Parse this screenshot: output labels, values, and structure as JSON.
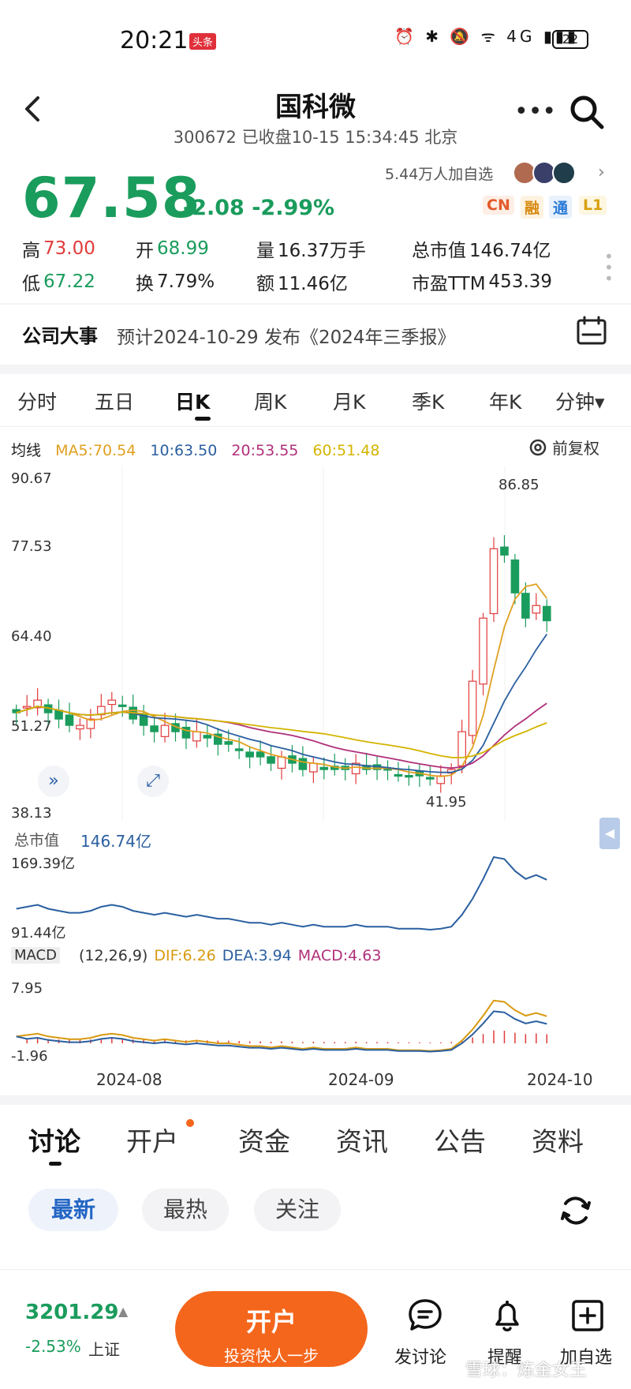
{
  "status_bar": {
    "time": "20:21",
    "badge": "头条",
    "icons": "⏰ ✱ 🔕 ᯤ 4G ▮▮▮",
    "battery": "22"
  },
  "header": {
    "title": "国科微",
    "subtitle": "300672 已收盘10-15 15:34:45 北京"
  },
  "quote": {
    "price": "67.58",
    "change": "-2.08 -2.99%",
    "followers": "5.44万人加自选",
    "tags": [
      "CN",
      "融",
      "通",
      "L1"
    ],
    "stats": [
      {
        "label": "高",
        "value": "73.00",
        "color": "#e23b3b"
      },
      {
        "label": "开",
        "value": "68.99",
        "color": "#1a9c5c"
      },
      {
        "label": "量",
        "value": "16.37万手",
        "color": "#222222"
      },
      {
        "label": "总市值",
        "value": "146.74亿",
        "color": "#222222"
      },
      {
        "label": "低",
        "value": "67.22",
        "color": "#1a9c5c"
      },
      {
        "label": "换",
        "value": "7.79%",
        "color": "#222222"
      },
      {
        "label": "额",
        "value": "11.46亿",
        "color": "#222222"
      },
      {
        "label": "市盈TTM",
        "value": "453.39",
        "color": "#222222"
      }
    ]
  },
  "event": {
    "title": "公司大事",
    "text": "预计2024-10-29 发布《2024年三季报》"
  },
  "kline_tabs": [
    "分时",
    "五日",
    "日K",
    "周K",
    "月K",
    "季K",
    "年K",
    "分钟▾"
  ],
  "chart_data": {
    "type": "candlestick",
    "ma_label": "均线",
    "ma": [
      {
        "name": "MA5:70.54",
        "color": "#e0a020"
      },
      {
        "name": "10:63.50",
        "color": "#2a5fa0"
      },
      {
        "name": "20:53.55",
        "color": "#b0307a"
      },
      {
        "name": "60:51.48",
        "color": "#d4b400"
      }
    ],
    "restore_label": "前复权",
    "y_ticks": [
      "90.67",
      "77.53",
      "64.40",
      "51.27",
      "38.13"
    ],
    "max_label": "86.85",
    "min_label": "41.95",
    "closes": [
      53,
      54,
      55,
      53,
      52,
      51,
      51,
      52,
      54,
      55,
      54,
      52,
      51,
      50,
      51,
      50,
      49,
      50,
      49,
      48,
      48,
      47,
      46,
      46,
      45,
      46,
      45,
      44,
      45,
      44,
      44,
      44,
      45,
      44,
      44,
      44,
      43,
      43,
      43,
      42.5,
      43,
      44,
      50,
      58,
      68,
      79,
      78,
      72,
      68,
      70,
      67.58
    ],
    "market_cap": {
      "label": "总市值",
      "value": "146.74亿",
      "max": "169.39亿",
      "min": "91.44亿"
    },
    "macd": {
      "label": "MACD",
      "params": "(12,26,9)",
      "dif": "DIF:6.26",
      "dea": "DEA:3.94",
      "macd": "MACD:4.63",
      "max": "7.95",
      "min": "-1.96"
    },
    "x_labels": [
      "2024-08",
      "2024-09",
      "2024-10"
    ]
  },
  "discussion": {
    "tabs": [
      "讨论",
      "开户",
      "资金",
      "资讯",
      "公告",
      "资料"
    ],
    "filters": [
      "最新",
      "最热",
      "关注"
    ]
  },
  "bottom": {
    "index_value": "3201.29",
    "index_change": "-2.53%",
    "index_name": "上证",
    "open_button": "开户",
    "open_sub": "投资快人一步",
    "actions": [
      "发讨论",
      "提醒",
      "加自选"
    ],
    "watermark": "雪球：炼金女王"
  }
}
